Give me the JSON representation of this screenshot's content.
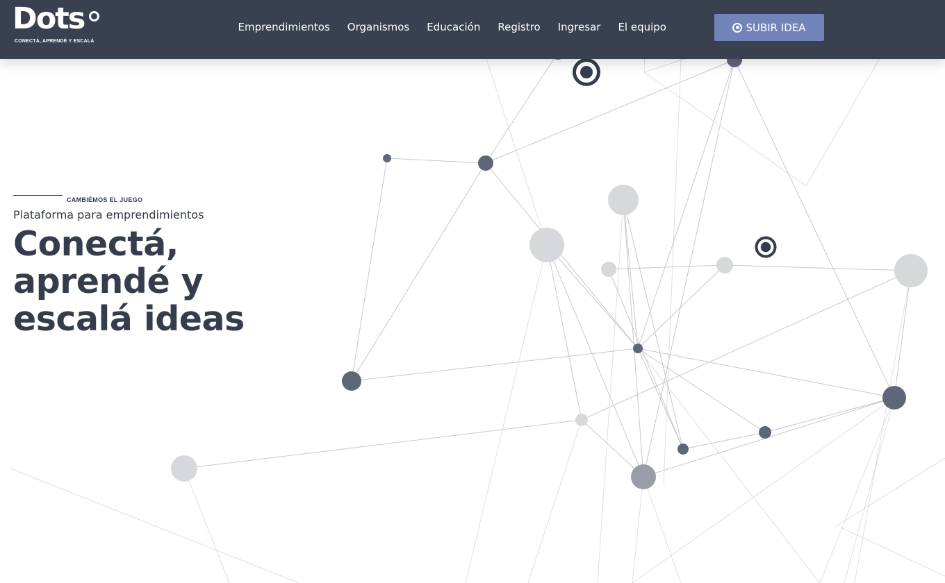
{
  "brand": {
    "name": "Dots",
    "tagline": "CONECTÁ, APRENDÉ Y ESCALÁ"
  },
  "nav": {
    "items": [
      {
        "label": "Emprendimientos"
      },
      {
        "label": "Organismos"
      },
      {
        "label": "Educación"
      },
      {
        "label": "Registro"
      },
      {
        "label": "Ingresar"
      },
      {
        "label": "El equipo"
      }
    ],
    "cta_label": "SUBIR IDEA",
    "cta_icon": "target-icon"
  },
  "hero": {
    "eyebrow": "CAMBIÉMOS EL JUEGO",
    "subtitle": "Plataforma para emprendimientos",
    "headline_lines": [
      "Conectá,",
      "aprendé y",
      "escalá ideas"
    ]
  },
  "colors": {
    "nav_bg": "#39404f",
    "cta_bg": "#7283b8",
    "headline": "#353d4c",
    "node_dark": "#5f6678",
    "node_mid": "#9a9da7",
    "node_light": "#d6d8dc",
    "line": "#c3c5ca"
  }
}
